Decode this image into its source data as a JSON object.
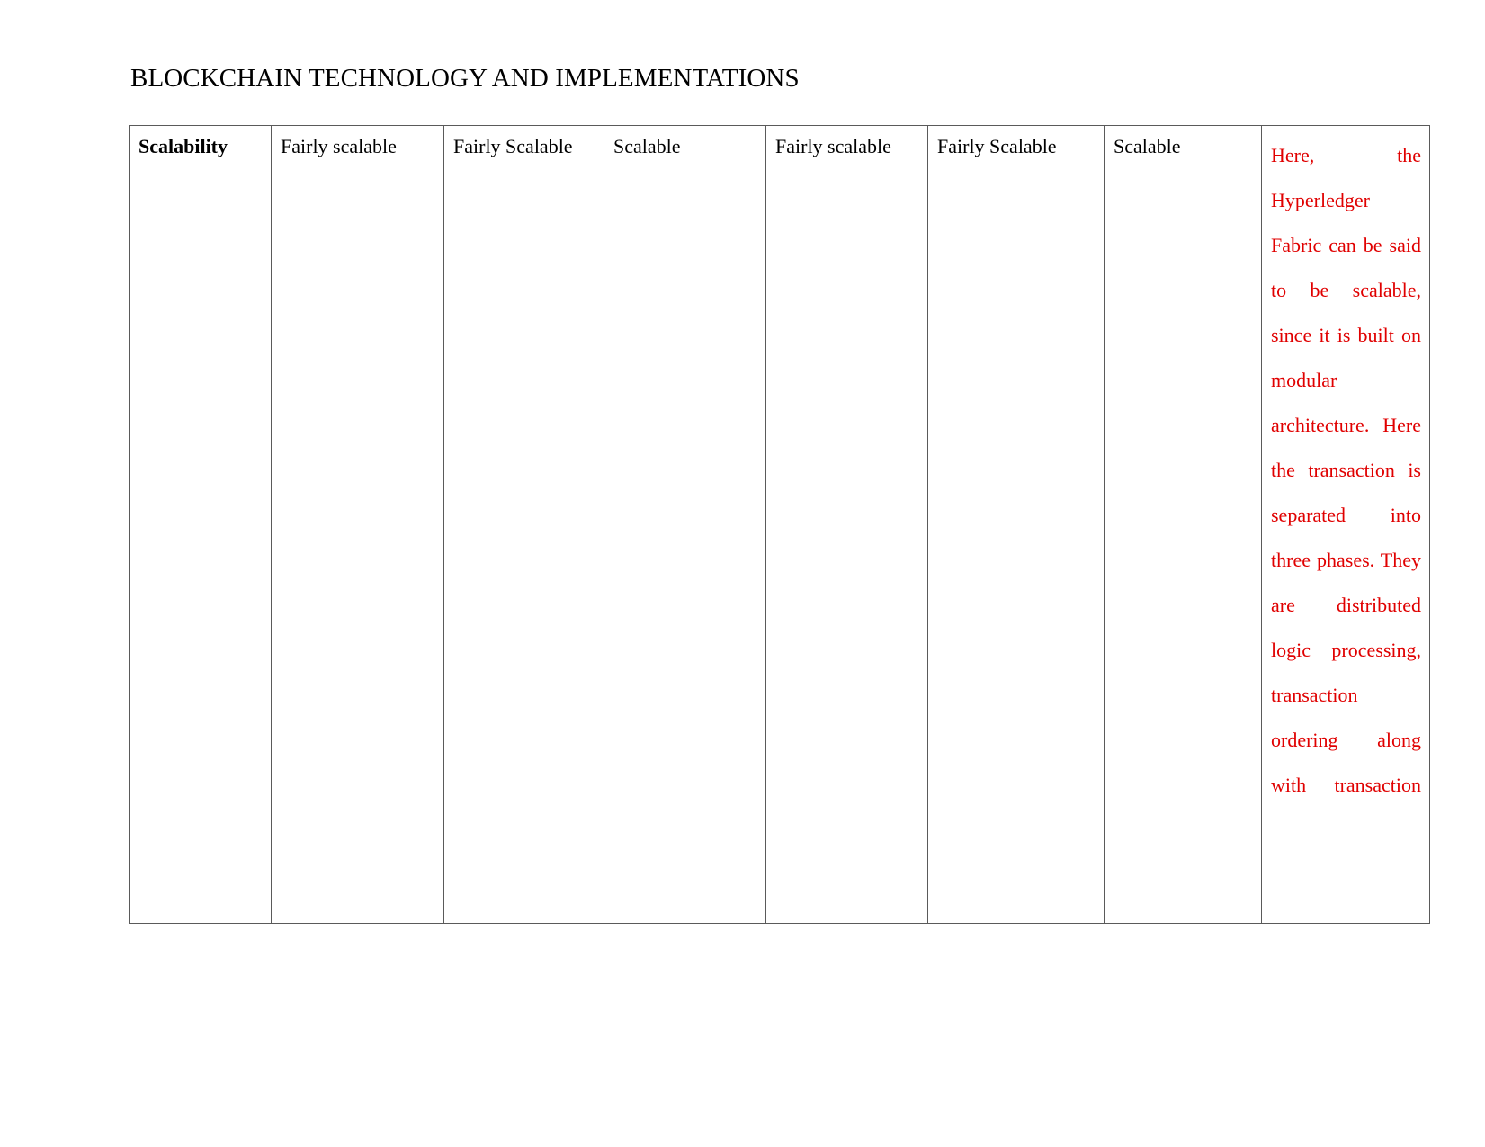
{
  "document": {
    "title": "BLOCKCHAIN TECHNOLOGY AND IMPLEMENTATIONS"
  },
  "colors": {
    "note_text": "#e00000",
    "body_text": "#000000",
    "table_border": "#5a5a5a",
    "page_background": "#ffffff"
  },
  "table": {
    "row": {
      "label": "Scalability",
      "cells": [
        "Fairly scalable",
        "Fairly Scalable",
        "Scalable",
        "Fairly scalable",
        "Fairly Scalable",
        "Scalable"
      ],
      "note": "Here, the Hyperledger Fabric can be said to be scalable, since it is built on modular architecture. Here the transaction is separated into three phases. They are distributed logic processing, transaction ordering along with transaction"
    }
  }
}
